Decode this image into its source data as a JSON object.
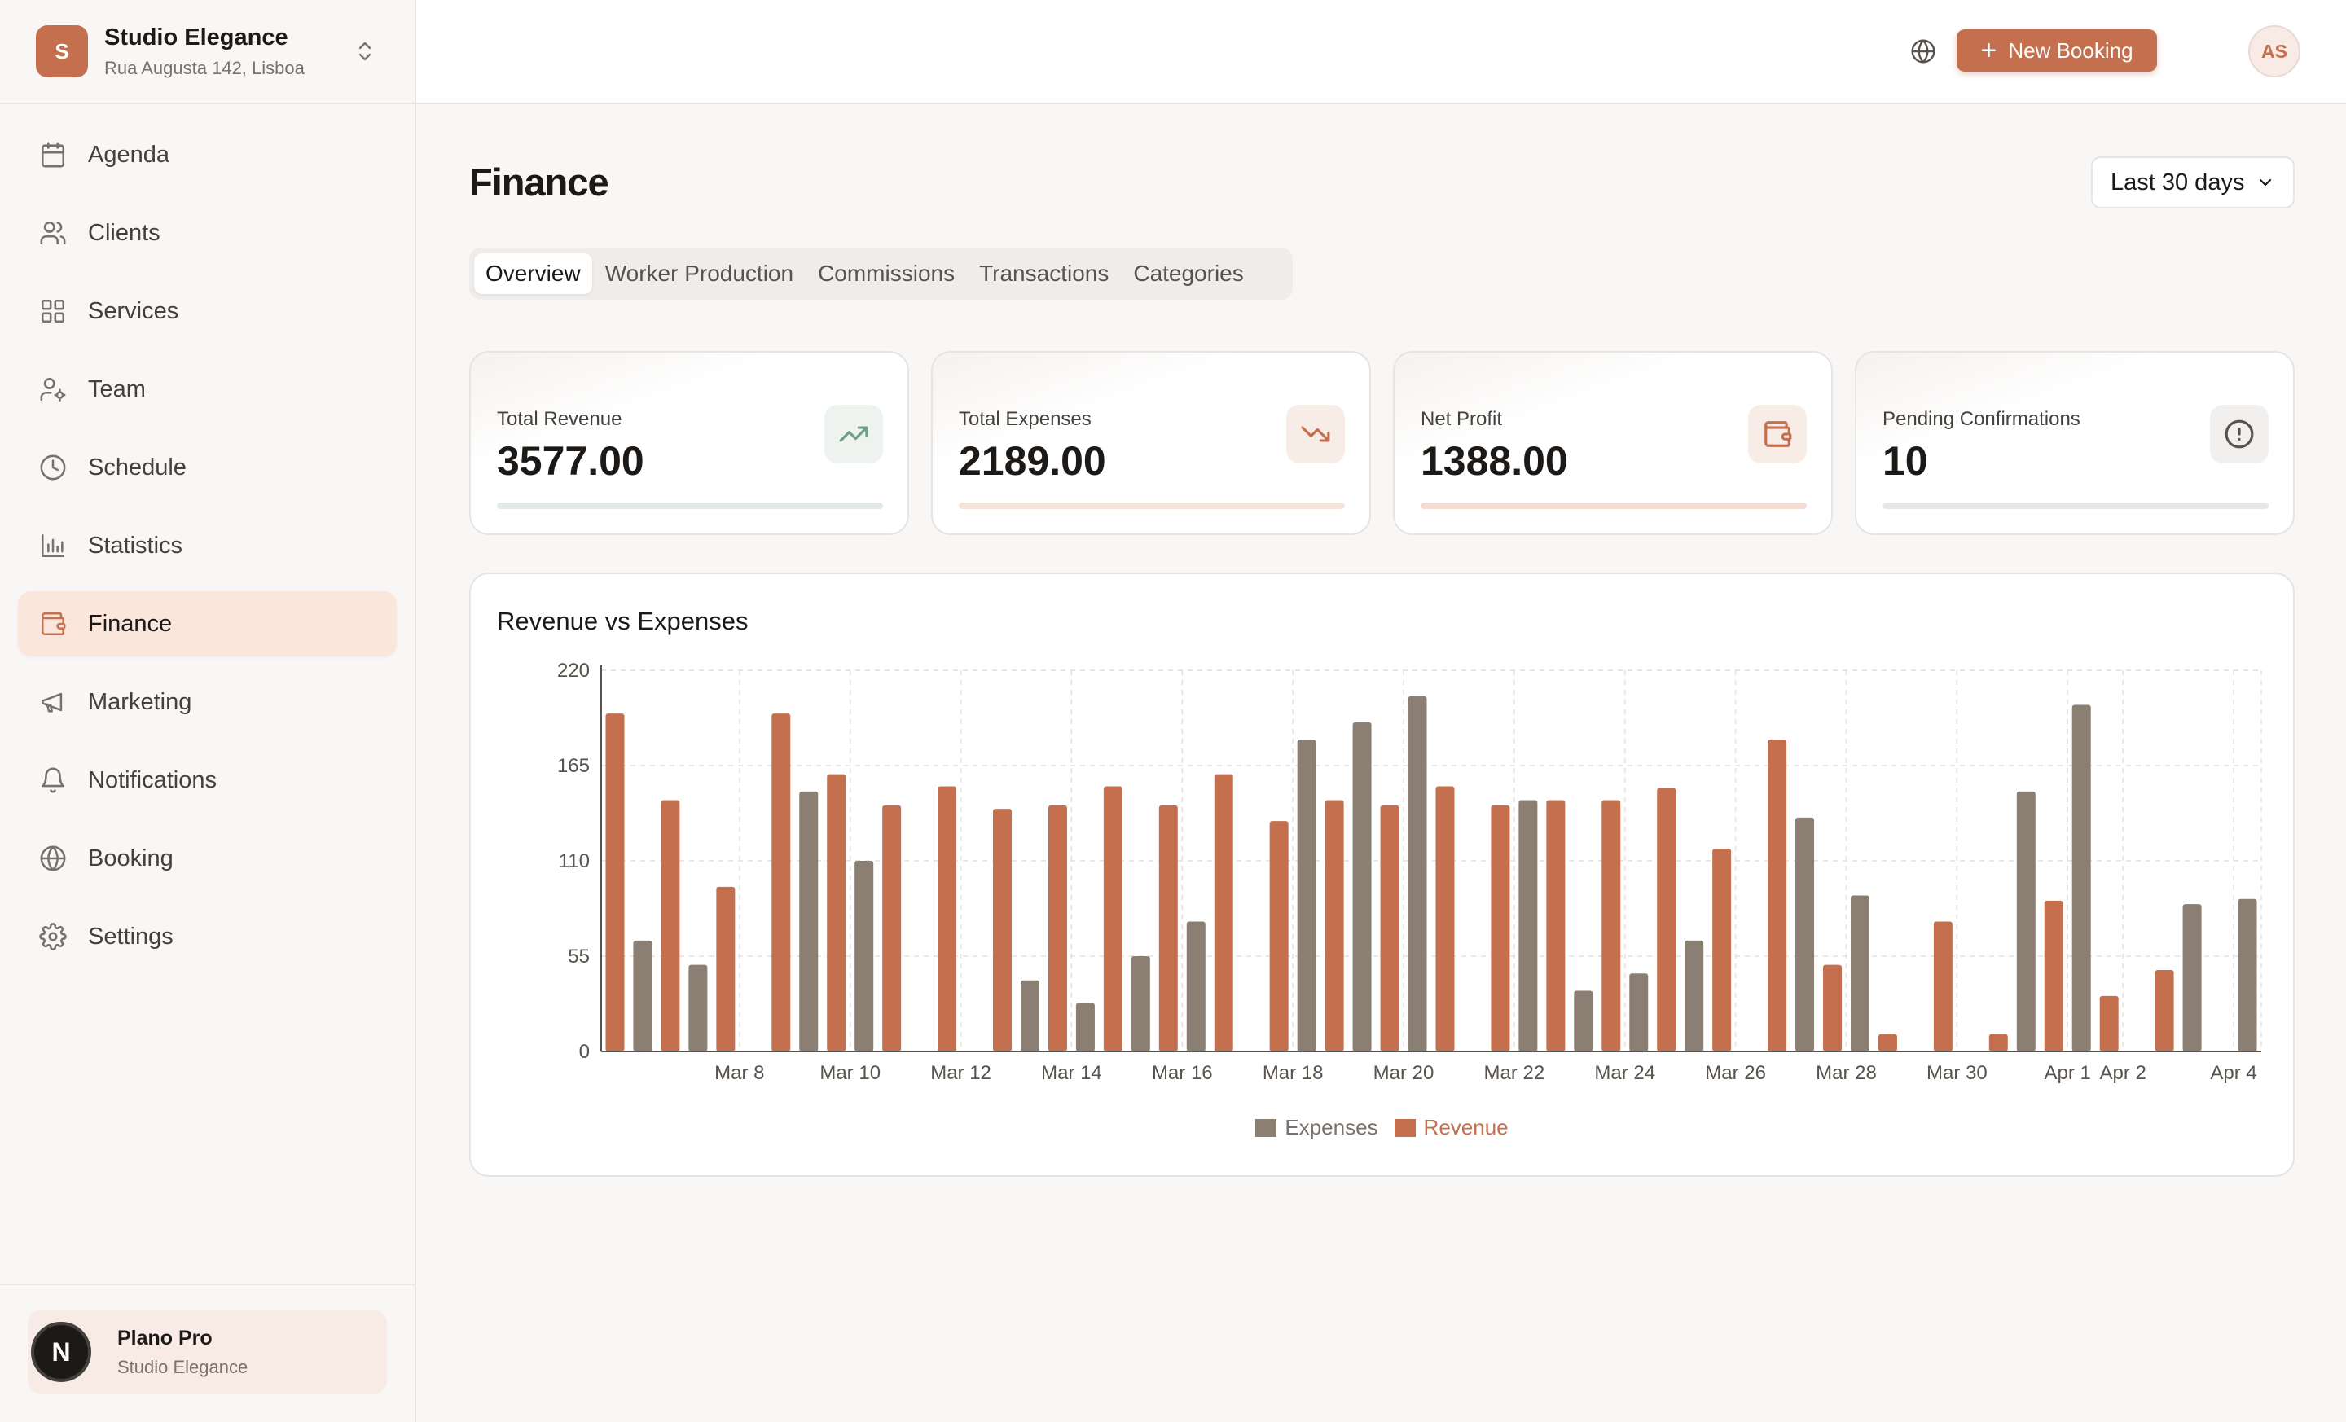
{
  "org": {
    "initial": "S",
    "name": "Studio Elegance",
    "address": "Rua Augusta 142, Lisboa"
  },
  "sidebar": {
    "items": [
      {
        "label": "Agenda",
        "icon": "calendar-icon"
      },
      {
        "label": "Clients",
        "icon": "users-icon"
      },
      {
        "label": "Services",
        "icon": "grid-icon"
      },
      {
        "label": "Team",
        "icon": "user-cog-icon"
      },
      {
        "label": "Schedule",
        "icon": "clock-icon"
      },
      {
        "label": "Statistics",
        "icon": "bar-chart-icon"
      },
      {
        "label": "Finance",
        "icon": "wallet-icon",
        "active": true
      },
      {
        "label": "Marketing",
        "icon": "megaphone-icon"
      },
      {
        "label": "Notifications",
        "icon": "bell-icon"
      },
      {
        "label": "Booking",
        "icon": "globe-icon"
      },
      {
        "label": "Settings",
        "icon": "gear-icon"
      }
    ]
  },
  "plan": {
    "avatar_letter": "N",
    "title": "Plano Pro",
    "subtitle": "Studio Elegance"
  },
  "topbar": {
    "new_booking_label": "New Booking",
    "user_initials": "AS"
  },
  "page": {
    "title": "Finance",
    "range": "Last 30 days",
    "tabs": [
      "Overview",
      "Worker Production",
      "Commissions",
      "Transactions",
      "Categories"
    ],
    "active_tab": "Overview"
  },
  "stats": [
    {
      "label": "Total Revenue",
      "value": "3577.00",
      "icon": "trending-up-icon",
      "color": "#6f9f86"
    },
    {
      "label": "Total Expenses",
      "value": "2189.00",
      "icon": "trending-down-icon",
      "color": "#c4704f"
    },
    {
      "label": "Net Profit",
      "value": "1388.00",
      "icon": "wallet-icon",
      "color": "#c4704f"
    },
    {
      "label": "Pending Confirmations",
      "value": "10",
      "icon": "alert-circle-icon",
      "color": "#78716c"
    }
  ],
  "colors": {
    "accent": "#c4704f",
    "expenses": "#8b7e72",
    "revenue": "#c4704f"
  },
  "chart_data": {
    "type": "bar",
    "title": "Revenue vs Expenses",
    "xlabel": "",
    "ylabel": "",
    "ylim": [
      0,
      220
    ],
    "yticks": [
      0,
      55,
      110,
      165,
      220
    ],
    "grid": true,
    "legend_position": "bottom",
    "categories": [
      "Mar 6",
      "Mar 7",
      "Mar 8",
      "Mar 9",
      "Mar 10",
      "Mar 11",
      "Mar 12",
      "Mar 13",
      "Mar 14",
      "Mar 15",
      "Mar 16",
      "Mar 17",
      "Mar 18",
      "Mar 19",
      "Mar 20",
      "Mar 21",
      "Mar 22",
      "Mar 23",
      "Mar 24",
      "Mar 25",
      "Mar 26",
      "Mar 27",
      "Mar 28",
      "Mar 29",
      "Mar 30",
      "Mar 31",
      "Apr 1",
      "Apr 2",
      "Apr 3",
      "Apr 4"
    ],
    "xtick_labels": [
      "Mar 8",
      "Mar 10",
      "Mar 12",
      "Mar 14",
      "Mar 16",
      "Mar 18",
      "Mar 20",
      "Mar 22",
      "Mar 24",
      "Mar 26",
      "Mar 28",
      "Mar 30",
      "Apr 1",
      "Apr 2",
      "Apr 4"
    ],
    "series": [
      {
        "name": "Revenue",
        "values": [
          195,
          145,
          95,
          195,
          160,
          142,
          153,
          140,
          142,
          153,
          142,
          160,
          133,
          145,
          142,
          153,
          142,
          145,
          145,
          152,
          117,
          180,
          50,
          10,
          75,
          10,
          87,
          32,
          47,
          0
        ]
      },
      {
        "name": "Expenses",
        "values": [
          64,
          50,
          0,
          150,
          110,
          0,
          0,
          41,
          28,
          55,
          75,
          0,
          180,
          190,
          205,
          0,
          145,
          35,
          45,
          64,
          0,
          135,
          90,
          0,
          0,
          150,
          200,
          0,
          85,
          88
        ]
      }
    ]
  }
}
